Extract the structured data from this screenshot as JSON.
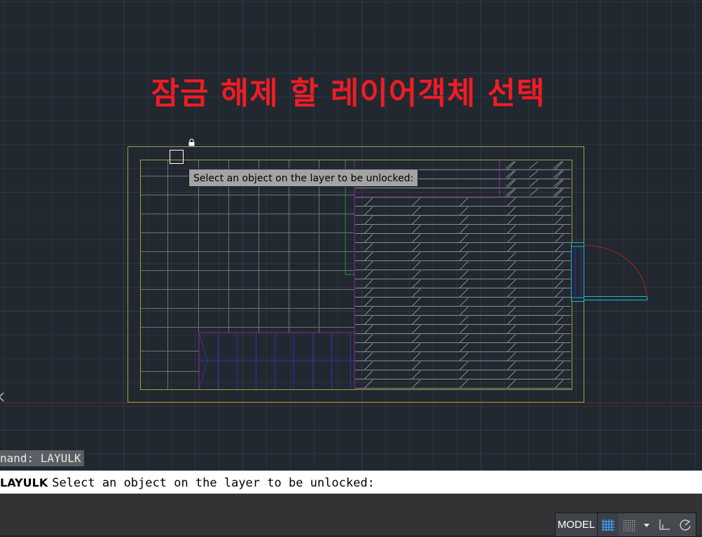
{
  "annotation": {
    "title": "잠금 해제 할 레이어객체 선택"
  },
  "tooltip": {
    "prompt": "Select an object on the layer to be unlocked:"
  },
  "command_history": {
    "text": "nand: LAYULK"
  },
  "command_line": {
    "command": "LAYULK",
    "prompt": "Select an object on the layer to be unlocked:"
  },
  "status_bar": {
    "model_label": "MODEL"
  },
  "icons": {
    "lock": "lock-icon",
    "pickbox": "pickbox-icon",
    "grid": "grid-icon",
    "snap": "snap-icon",
    "dropdown": "dropdown-arrow-icon",
    "ortho": "ortho-icon",
    "polar": "polar-tracking-icon"
  },
  "colors": {
    "background": "#212830",
    "annotation": "#ee1c25",
    "wall": "#a0a03c",
    "partition": "#8e2a9c",
    "hatch": "#8a8d93",
    "tile": "#7a7d82",
    "stair": "#2b36a8",
    "door_frame": "#22b8c4",
    "door_swing": "#b81f1f",
    "partition_green": "#1e9a2a"
  }
}
